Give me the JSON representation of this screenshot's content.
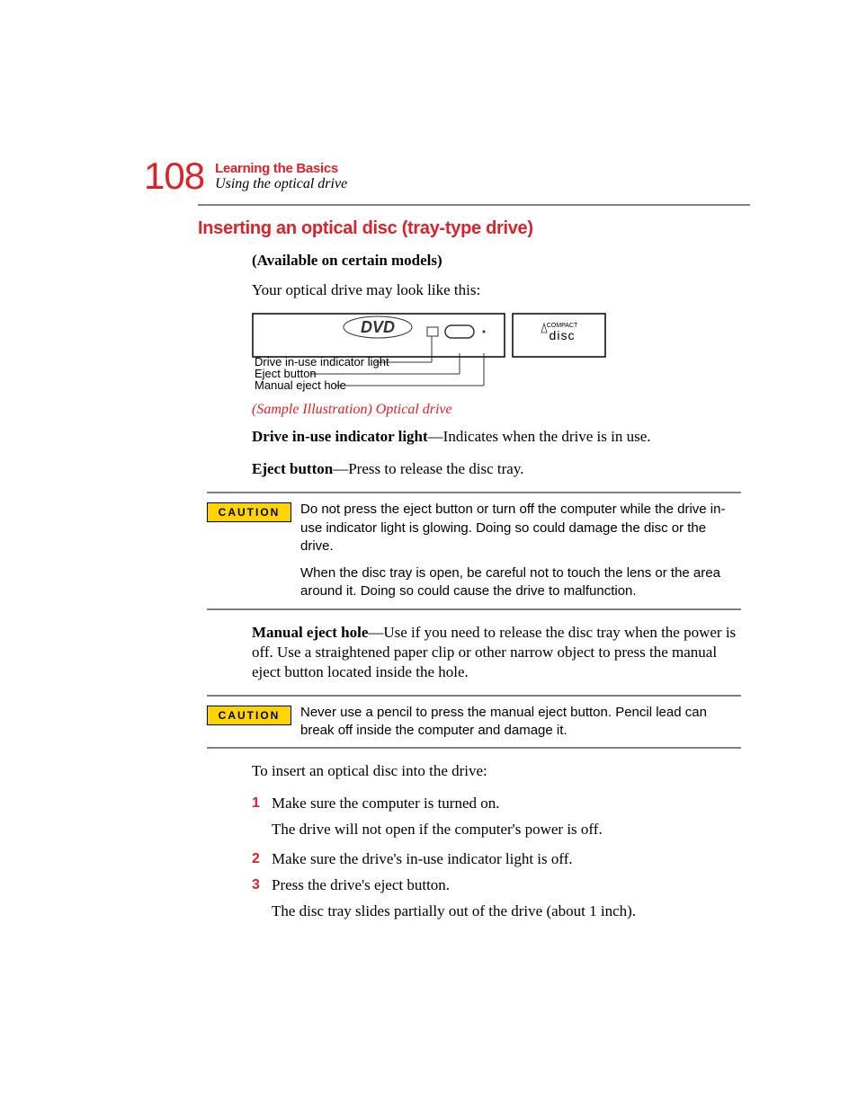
{
  "header": {
    "page_number": "108",
    "chapter": "Learning the Basics",
    "section": "Using the optical drive"
  },
  "heading": "Inserting an optical disc (tray-type drive)",
  "sub_note": "(Available on certain models)",
  "intro": "Your optical drive may look like this:",
  "illustration": {
    "callouts": {
      "line1": "Drive in-use indicator light",
      "line2": "Eject button",
      "line3": "Manual eject hole"
    },
    "caption": "(Sample Illustration) Optical drive"
  },
  "defs": {
    "d1": {
      "term": "Drive in-use indicator light",
      "text": "—Indicates when the drive is in use."
    },
    "d2": {
      "term": "Eject button",
      "text": "—Press to release the disc tray."
    }
  },
  "caution1": {
    "label": "CAUTION",
    "p1": "Do not press the eject button or turn off the computer while the drive in-use indicator light is glowing. Doing so could damage the disc or the drive.",
    "p2": "When the disc tray is open, be careful not to touch the lens or the area around it. Doing so could cause the drive to malfunction."
  },
  "defs2": {
    "d3": {
      "term": "Manual eject hole",
      "text": "—Use if you need to release the disc tray when the power is off. Use a straightened paper clip or other narrow object to press the manual eject button located inside the hole."
    }
  },
  "caution2": {
    "label": "CAUTION",
    "p1": "Never use a pencil to press the manual eject button. Pencil lead can break off inside the computer and damage it."
  },
  "insert_intro": "To insert an optical disc into the drive:",
  "steps": {
    "s1": {
      "num": "1",
      "text": "Make sure the computer is turned on.",
      "sub": "The drive will not open if the computer's power is off."
    },
    "s2": {
      "num": "2",
      "text": "Make sure the drive's in-use indicator light is off."
    },
    "s3": {
      "num": "3",
      "text": "Press the drive's eject button.",
      "sub": "The disc tray slides partially out of the drive (about 1 inch)."
    }
  }
}
